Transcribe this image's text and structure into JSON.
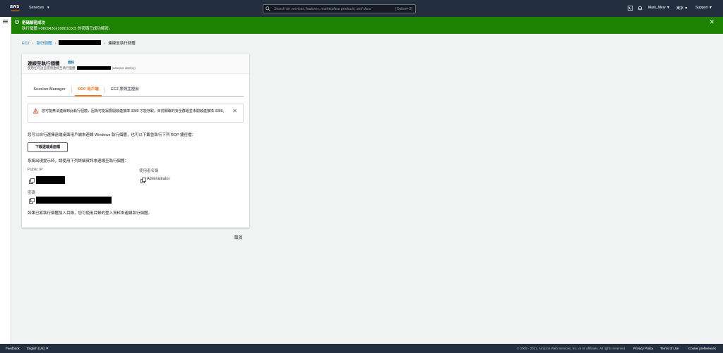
{
  "topnav": {
    "logo_text": "aws",
    "services_label": "Services",
    "search_placeholder": "Search for services, features, marketplace products, and docs",
    "search_shortcut": "[Option+S]",
    "user": "Mark_Mew",
    "region": "東京",
    "support": "Support"
  },
  "flash": {
    "title": "密碼解密成功",
    "message": "執行個體 i-08c043ce10801c0c5 的密碼已成功解密。"
  },
  "breadcrumb": {
    "ec2": "EC2",
    "instances": "執行個體",
    "current": "連線至執行個體"
  },
  "card": {
    "title": "連線至執行個體",
    "info": "資訊",
    "subtitle_prefix": "使用任何這些選項連線至執行個體",
    "subtitle_suffix": "(octopus deploy)"
  },
  "tabs": [
    "Session Manager",
    "RDP 用戶端",
    "EC2 序列主控台"
  ],
  "alert": {
    "text": "您可能無法連線到此執行個體，因為可能需要開啟連接埠 3389 才能存取。目前關聯的安全群組並未開啟連接埠 3389。"
  },
  "body": {
    "intro": "您可以自行選擇遠端桌面用戶端來連線 Windows 執行個體，也可以下載並執行下列 RDP 捷徑檔：",
    "download_button": "下載遠端桌面檔",
    "prompt": "系統出現提示時，請使用下列詳細資訊來連線至執行個體：",
    "public_ip_label": "Public IP",
    "username_label": "使用者名稱",
    "username_value": "Administrator",
    "password_label": "密碼",
    "domain_note": "如果已將執行個體加入目錄，您可使用目錄的登入資料來連線執行個體。"
  },
  "cancel_label": "取消",
  "footer": {
    "feedback": "Feedback",
    "language": "English (US)",
    "copyright": "© 2008 - 2021, Amazon Web Services, Inc. or its affiliates. All rights reserved.",
    "privacy": "Privacy Policy",
    "terms": "Terms of Use",
    "cookies": "Cookie preferences"
  },
  "colors": {
    "nav_bg": "#232f3e",
    "success": "#1d8102",
    "link": "#0073bb",
    "accent": "#ec7211",
    "error": "#d13212"
  }
}
